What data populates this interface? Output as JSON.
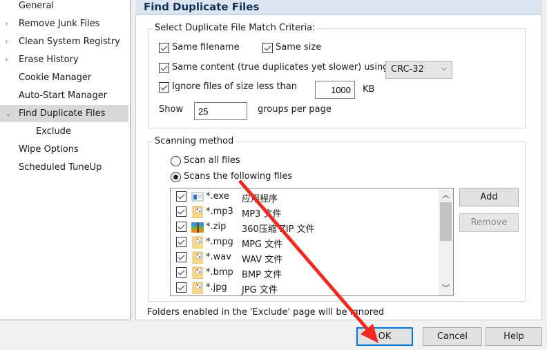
{
  "sidebar": {
    "items": [
      {
        "label": "General",
        "expander": ""
      },
      {
        "label": "Remove Junk Files",
        "expander": "›"
      },
      {
        "label": "Clean System Registry",
        "expander": "›"
      },
      {
        "label": "Erase History",
        "expander": "›"
      },
      {
        "label": "Cookie Manager",
        "expander": ""
      },
      {
        "label": "Auto-Start Manager",
        "expander": ""
      },
      {
        "label": "Find Duplicate Files",
        "expander": "⌄",
        "selected": true
      },
      {
        "label": "Exclude",
        "expander": "",
        "child": true
      },
      {
        "label": "Wipe Options",
        "expander": ""
      },
      {
        "label": "Scheduled TuneUp",
        "expander": ""
      }
    ]
  },
  "header": {
    "title": "Find Duplicate Files"
  },
  "criteria": {
    "legend": "Select Duplicate File Match Criteria:",
    "same_filename": "Same filename",
    "same_size": "Same size",
    "same_content": "Same content (true duplicates yet slower) using",
    "hash_select": "CRC-32",
    "ignore_small": "Ignore files of size less than",
    "min_size": "1000",
    "size_unit": "KB",
    "show_label": "Show",
    "groups_value": "25",
    "groups_suffix": "groups per page"
  },
  "scanning": {
    "legend": "Scanning method",
    "scan_all": "Scan all files",
    "scan_following": "Scans the following files",
    "files": [
      {
        "ext": "*.exe",
        "desc": "应用程序",
        "icon": "exe"
      },
      {
        "ext": "*.mp3",
        "desc": "MP3 文件",
        "icon": "file"
      },
      {
        "ext": "*.zip",
        "desc": "360压缩 ZIP 文件",
        "icon": "zip"
      },
      {
        "ext": "*.mpg",
        "desc": "MPG 文件",
        "icon": "file"
      },
      {
        "ext": "*.wav",
        "desc": "WAV 文件",
        "icon": "file"
      },
      {
        "ext": "*.bmp",
        "desc": "BMP 文件",
        "icon": "file"
      },
      {
        "ext": "*.jpg",
        "desc": "JPG 文件",
        "icon": "file"
      }
    ],
    "add": "Add",
    "remove": "Remove"
  },
  "footer_note": "Folders enabled in the 'Exclude' page will be ignored",
  "buttons": {
    "ok": "OK",
    "cancel": "Cancel",
    "help": "Help"
  },
  "colors": {
    "annotation_arrow": "#f02a20",
    "ok_border": "#0078d7"
  }
}
